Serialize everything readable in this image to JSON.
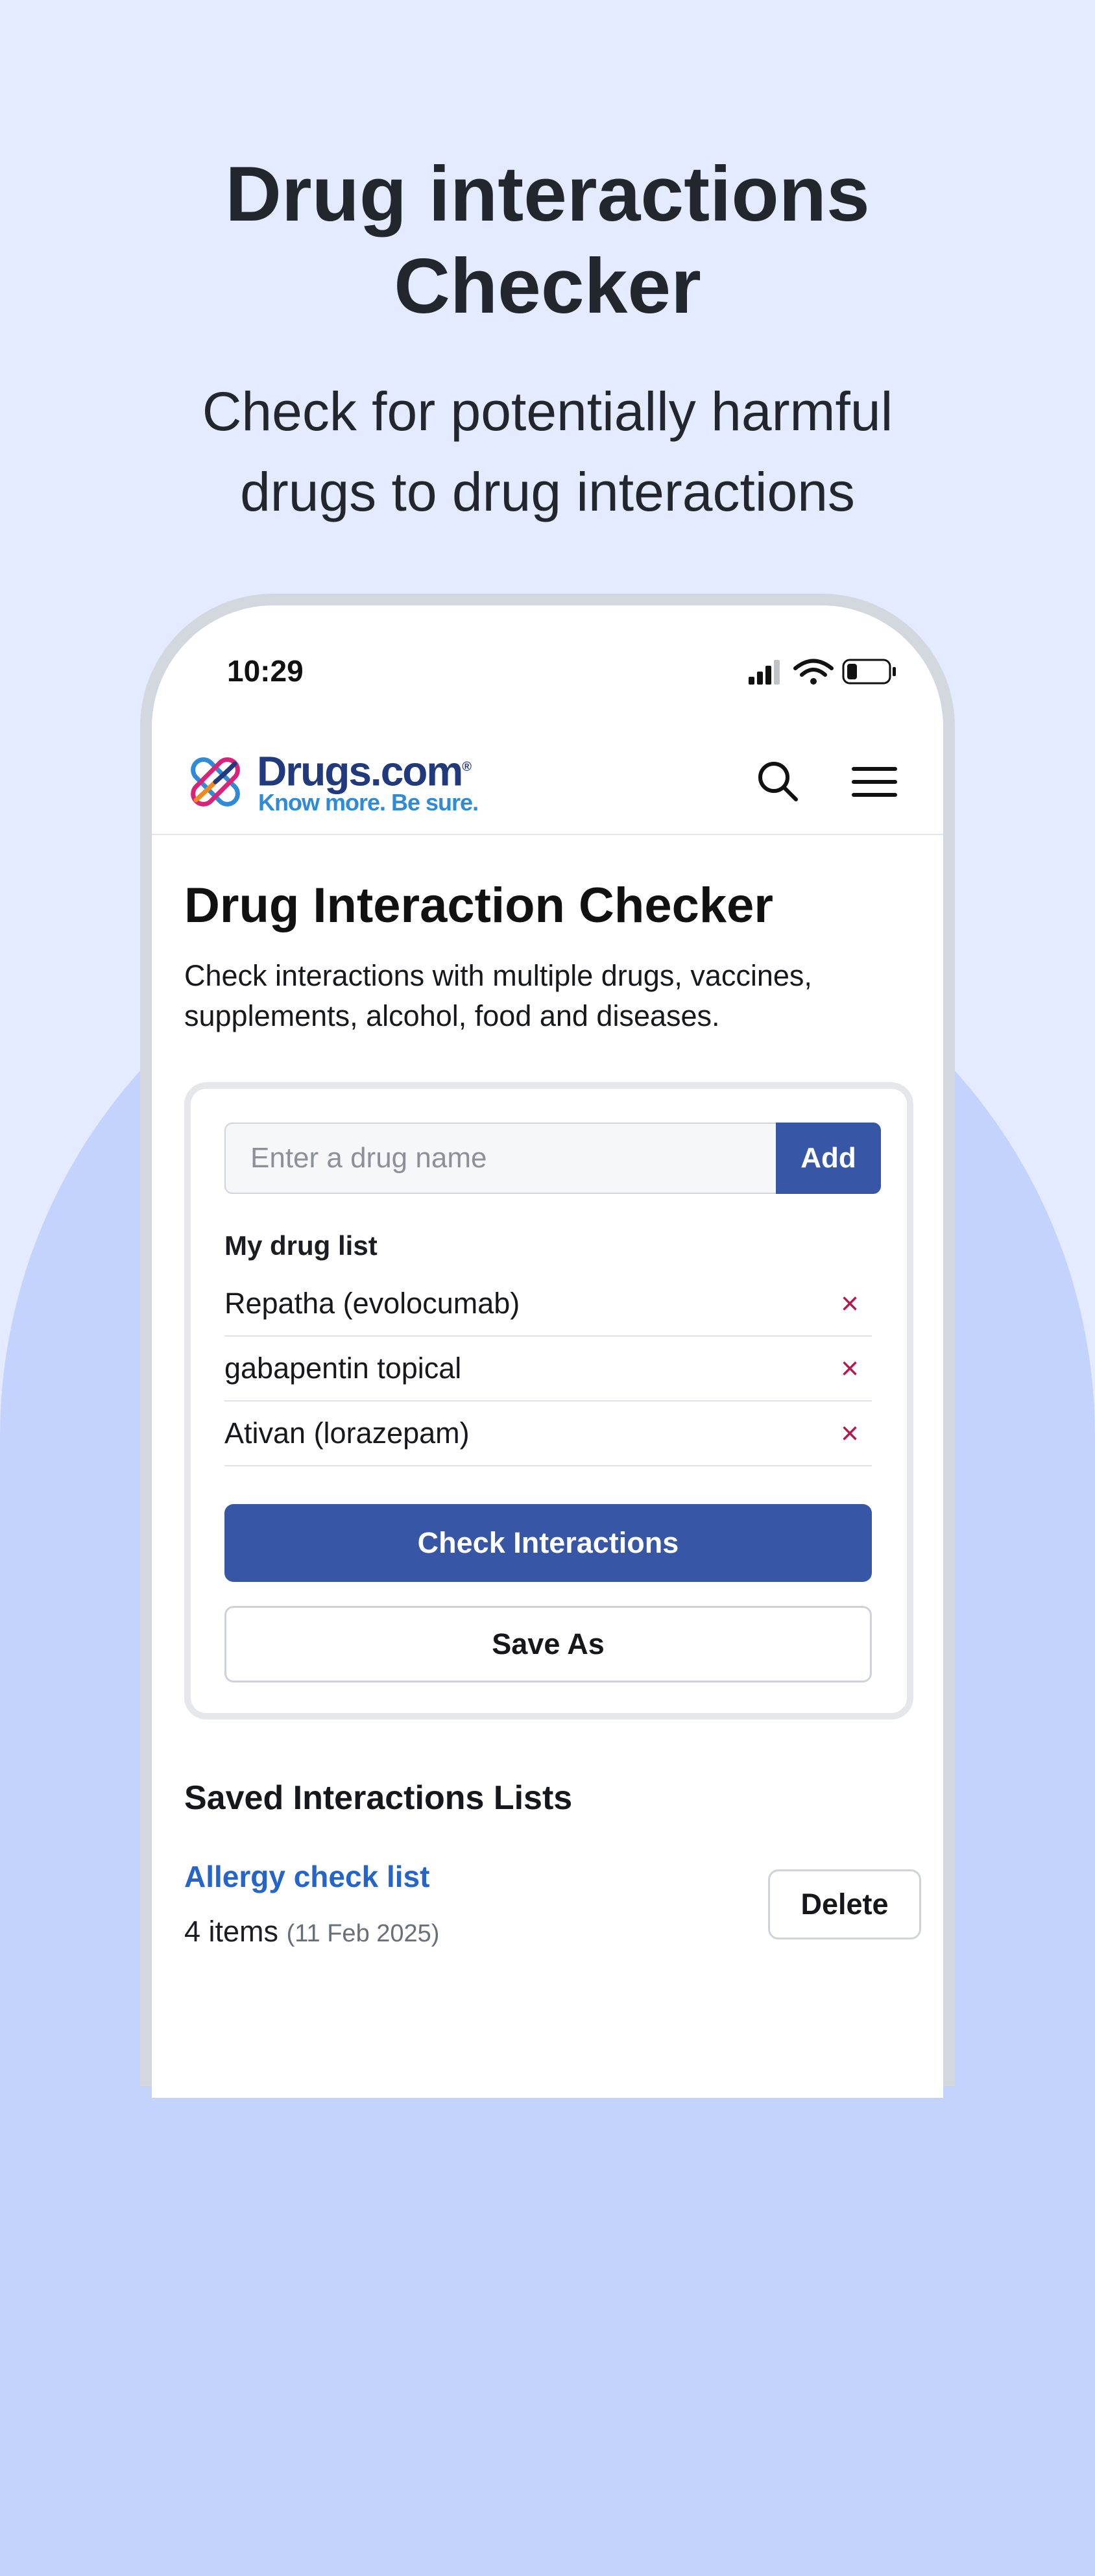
{
  "promo": {
    "title_line1": "Drug interactions",
    "title_line2": "Checker",
    "subtitle_line1": "Check for potentially harmful",
    "subtitle_line2": "drugs to drug interactions"
  },
  "status_bar": {
    "time": "10:29",
    "battery_level": 0.25
  },
  "header": {
    "logo_name": "Drugs.com",
    "logo_mark": "®",
    "logo_tagline": "Know more. Be sure.",
    "search_icon": "search-icon",
    "menu_icon": "hamburger-menu-icon"
  },
  "page": {
    "title": "Drug Interaction Checker",
    "description": "Check interactions with multiple drugs, vaccines, supplements, alcohol, food and diseases."
  },
  "checker": {
    "input_placeholder": "Enter a drug name",
    "input_value": "",
    "add_label": "Add",
    "list_label": "My drug list",
    "drugs": [
      {
        "name": "Repatha (evolocumab)",
        "remove": "×"
      },
      {
        "name": "gabapentin topical",
        "remove": "×"
      },
      {
        "name": "Ativan (lorazepam)",
        "remove": "×"
      }
    ],
    "check_label": "Check Interactions",
    "save_label": "Save As"
  },
  "saved": {
    "heading": "Saved Interactions Lists",
    "lists": [
      {
        "name": "Allergy check list",
        "count": "4 items",
        "date": "(11 Feb 2025)",
        "delete_label": "Delete"
      }
    ]
  },
  "colors": {
    "primary": "#3756a5",
    "link": "#2565c9",
    "remove": "#b5174e",
    "background": "#e4ebfe",
    "arch": "#c4d3fd",
    "logo_navy": "#213a7d",
    "logo_blue": "#2f8bd6"
  }
}
